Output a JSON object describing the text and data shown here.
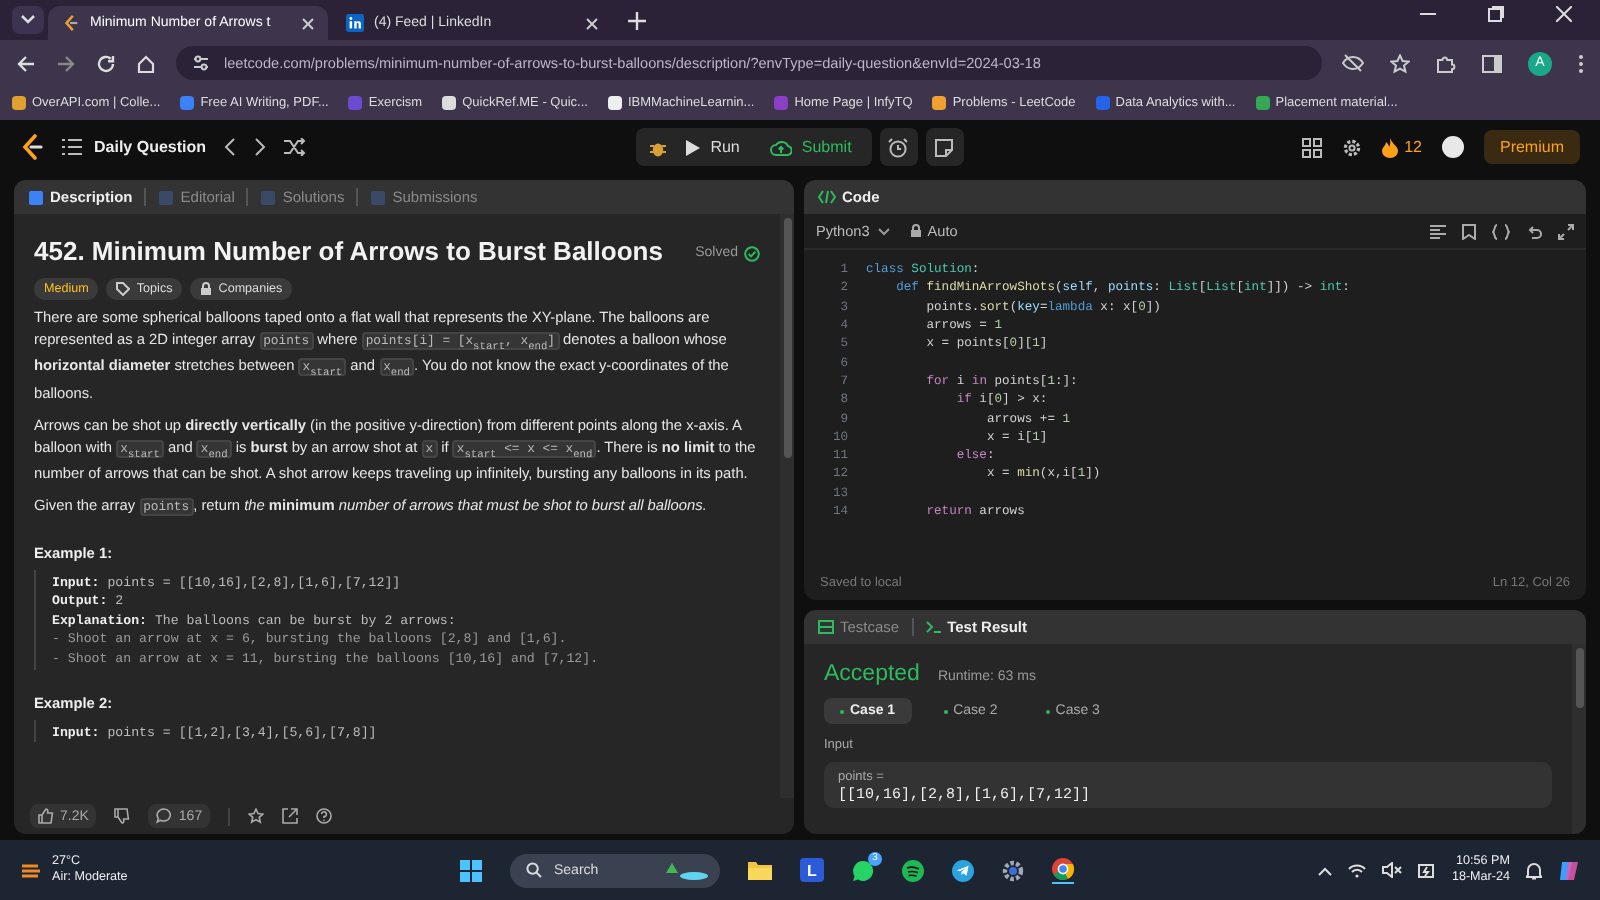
{
  "browser": {
    "tabs": [
      {
        "title": "Minimum Number of Arrows t",
        "kind": "leetcode",
        "selected": true
      },
      {
        "title": "(4) Feed | LinkedIn",
        "kind": "linkedin",
        "selected": false
      }
    ],
    "url": "leetcode.com/problems/minimum-number-of-arrows-to-burst-balloons/description/?envType=daily-question&envId=2024-03-18",
    "profile_initial": "A",
    "bookmarks": [
      {
        "label": "OverAPI.com | Colle...",
        "color": "#e0a030"
      },
      {
        "label": "Free AI Writing, PDF...",
        "color": "#3b82f6"
      },
      {
        "label": "Exercism",
        "color": "#6d4bd1"
      },
      {
        "label": "QuickRef.ME - Quic...",
        "color": "#dddddd"
      },
      {
        "label": "IBMMachineLearnin...",
        "color": "#eeeeee"
      },
      {
        "label": "Home Page | InfyTQ",
        "color": "#8b3fc7"
      },
      {
        "label": "Problems - LeetCode",
        "color": "#f0a030"
      },
      {
        "label": "Data Analytics with...",
        "color": "#2563eb"
      },
      {
        "label": "Placement material...",
        "color": "#34a853"
      }
    ]
  },
  "header": {
    "title": "Daily Question",
    "run": "Run",
    "submit": "Submit",
    "streak": "12",
    "premium": "Premium"
  },
  "left": {
    "tabs": [
      {
        "label": "Description",
        "selected": true
      },
      {
        "label": "Editorial",
        "selected": false
      },
      {
        "label": "Solutions",
        "selected": false
      },
      {
        "label": "Submissions",
        "selected": false
      }
    ],
    "title": "452. Minimum Number of Arrows to Burst Balloons",
    "status": "Solved",
    "difficulty": "Medium",
    "tags": [
      {
        "label": "Topics",
        "kind": "tag"
      },
      {
        "label": "Companies",
        "kind": "lock"
      }
    ],
    "paragraphs": [
      [
        {
          "kind": "text",
          "text": "There are some spherical balloons taped onto a flat wall that represents the XY-plane. The balloons are represented as a 2D integer array "
        },
        {
          "kind": "code",
          "text": "points"
        },
        {
          "kind": "text",
          "text": " where "
        },
        {
          "kind": "code",
          "text": "points[i] = [x$_{start}$, x$_{end}$]"
        },
        {
          "kind": "text",
          "text": " denotes a balloon whose **horizontal diameter** stretches between "
        },
        {
          "kind": "code",
          "text": "x$_{start}$"
        },
        {
          "kind": "text",
          "text": " and "
        },
        {
          "kind": "code",
          "text": "x$_{end}$"
        },
        {
          "kind": "text",
          "text": ". You do not know the exact y-coordinates of the balloons."
        }
      ],
      [
        {
          "kind": "text",
          "text": "Arrows can be shot up **directly vertically** (in the positive y-direction) from different points along the x-axis. A balloon with "
        },
        {
          "kind": "code",
          "text": "x$_{start}$"
        },
        {
          "kind": "text",
          "text": " and "
        },
        {
          "kind": "code",
          "text": "x$_{end}$"
        },
        {
          "kind": "text",
          "text": " is **burst** by an arrow shot at "
        },
        {
          "kind": "code",
          "text": "x"
        },
        {
          "kind": "text",
          "text": " if "
        },
        {
          "kind": "code",
          "text": "x$_{start}$ <= x <= x$_{end}$"
        },
        {
          "kind": "text",
          "text": ". There is **no limit** to the number of arrows that can be shot. A shot arrow keeps traveling up infinitely, bursting any balloons in its path."
        }
      ],
      [
        {
          "kind": "text",
          "text": "Given the array "
        },
        {
          "kind": "code",
          "text": "points"
        },
        {
          "kind": "text",
          "text": ", return *the* **minimum** *number of arrows that must be shot to burst all balloons.*"
        }
      ]
    ],
    "examples": [
      {
        "title": "Example 1:",
        "lines": [
          {
            "label": "Input:",
            "text": " points = [[10,16],[2,8],[1,6],[7,12]]"
          },
          {
            "label": "Output:",
            "text": " 2"
          },
          {
            "label": "Explanation:",
            "text": " The balloons can be burst by 2 arrows:"
          },
          {
            "text": "- Shoot an arrow at x = 6, bursting the balloons [2,8] and [1,6]."
          },
          {
            "text": "- Shoot an arrow at x = 11, bursting the balloons [10,16] and [7,12]."
          }
        ]
      },
      {
        "title": "Example 2:",
        "lines": [
          {
            "label": "Input:",
            "text": " points = [[1,2],[3,4],[5,6],[7,8]]"
          }
        ]
      }
    ],
    "likes": "7.2K",
    "comments": "167"
  },
  "code": {
    "title": "Code",
    "language": "Python3",
    "mode": "Auto",
    "lines": [
      {
        "number": "1",
        "tokens": [
          {
            "kind": "storage",
            "text": "class"
          },
          {
            "kind": "class",
            "text": " Solution"
          },
          {
            "kind": "plain",
            "text": ":"
          }
        ]
      },
      {
        "number": "2",
        "tokens": [
          {
            "kind": "storage",
            "text": "    def"
          },
          {
            "kind": "function",
            "text": " findMinArrowShots"
          },
          {
            "kind": "plain",
            "text": "("
          },
          {
            "kind": "param",
            "text": "self"
          },
          {
            "kind": "plain",
            "text": ", "
          },
          {
            "kind": "param",
            "text": "points"
          },
          {
            "kind": "plain",
            "text": ": "
          },
          {
            "kind": "class",
            "text": "List"
          },
          {
            "kind": "plain",
            "text": "["
          },
          {
            "kind": "class",
            "text": "List"
          },
          {
            "kind": "plain",
            "text": "["
          },
          {
            "kind": "class",
            "text": "int"
          },
          {
            "kind": "plain",
            "text": "]]) -> "
          },
          {
            "kind": "class",
            "text": "int"
          },
          {
            "kind": "plain",
            "text": ":"
          }
        ]
      },
      {
        "number": "3",
        "tokens": [
          {
            "kind": "plain",
            "text": "        points."
          },
          {
            "kind": "function",
            "text": "sort"
          },
          {
            "kind": "plain",
            "text": "("
          },
          {
            "kind": "param",
            "text": "key"
          },
          {
            "kind": "plain",
            "text": "="
          },
          {
            "kind": "storage",
            "text": "lambda"
          },
          {
            "kind": "plain",
            "text": " x: x["
          },
          {
            "kind": "number",
            "text": "0"
          },
          {
            "kind": "plain",
            "text": "])"
          }
        ]
      },
      {
        "number": "4",
        "tokens": [
          {
            "kind": "plain",
            "text": "        arrows = "
          },
          {
            "kind": "number",
            "text": "1"
          }
        ]
      },
      {
        "number": "5",
        "tokens": [
          {
            "kind": "plain",
            "text": "        x = points["
          },
          {
            "kind": "number",
            "text": "0"
          },
          {
            "kind": "plain",
            "text": "]["
          },
          {
            "kind": "number",
            "text": "1"
          },
          {
            "kind": "plain",
            "text": "]"
          }
        ]
      },
      {
        "number": "6"
      },
      {
        "number": "7",
        "tokens": [
          {
            "kind": "keyword",
            "text": "        for"
          },
          {
            "kind": "plain",
            "text": " i "
          },
          {
            "kind": "keyword",
            "text": "in"
          },
          {
            "kind": "plain",
            "text": " points["
          },
          {
            "kind": "number",
            "text": "1"
          },
          {
            "kind": "plain",
            "text": ":]:"
          }
        ]
      },
      {
        "number": "8",
        "tokens": [
          {
            "kind": "keyword",
            "text": "            if"
          },
          {
            "kind": "plain",
            "text": " i["
          },
          {
            "kind": "number",
            "text": "0"
          },
          {
            "kind": "plain",
            "text": "] > x:"
          }
        ]
      },
      {
        "number": "9",
        "tokens": [
          {
            "kind": "plain",
            "text": "                arrows += "
          },
          {
            "kind": "number",
            "text": "1"
          }
        ]
      },
      {
        "number": "10",
        "tokens": [
          {
            "kind": "plain",
            "text": "                x = i["
          },
          {
            "kind": "number",
            "text": "1"
          },
          {
            "kind": "plain",
            "text": "]"
          }
        ]
      },
      {
        "number": "11",
        "tokens": [
          {
            "kind": "keyword",
            "text": "            else"
          },
          {
            "kind": "plain",
            "text": ":"
          }
        ]
      },
      {
        "number": "12",
        "tokens": [
          {
            "kind": "plain",
            "text": "                x = "
          },
          {
            "kind": "function",
            "text": "min"
          },
          {
            "kind": "plain",
            "text": "(x,i["
          },
          {
            "kind": "number",
            "text": "1"
          },
          {
            "kind": "plain",
            "text": "])"
          }
        ]
      },
      {
        "number": "13"
      },
      {
        "number": "14",
        "tokens": [
          {
            "kind": "keyword",
            "text": "        return"
          },
          {
            "kind": "plain",
            "text": " arrows"
          }
        ]
      }
    ],
    "saved": "Saved to local",
    "position": "Ln 12, Col 26"
  },
  "test": {
    "tabs": [
      {
        "label": "Testcase",
        "selected": false
      },
      {
        "label": "Test Result",
        "selected": true
      }
    ],
    "verdict": "Accepted",
    "runtime": "Runtime: 63 ms",
    "cases": [
      {
        "label": "Case 1",
        "selected": true
      },
      {
        "label": "Case 2",
        "selected": false
      },
      {
        "label": "Case 3",
        "selected": false
      }
    ],
    "input_label": "Input",
    "param": "points =",
    "value": "[[10,16],[2,8],[1,6],[7,12]]"
  },
  "taskbar": {
    "temperature": "27°C",
    "air": "Air: Moderate",
    "search": "Search",
    "apps": [
      {
        "kind": "files"
      },
      {
        "kind": "letter",
        "label": "L"
      },
      {
        "kind": "chat",
        "badge": "3"
      },
      {
        "kind": "music"
      },
      {
        "kind": "telegram"
      },
      {
        "kind": "settings"
      },
      {
        "kind": "browser"
      }
    ],
    "time": "10:56 PM",
    "date": "18-Mar-24"
  }
}
